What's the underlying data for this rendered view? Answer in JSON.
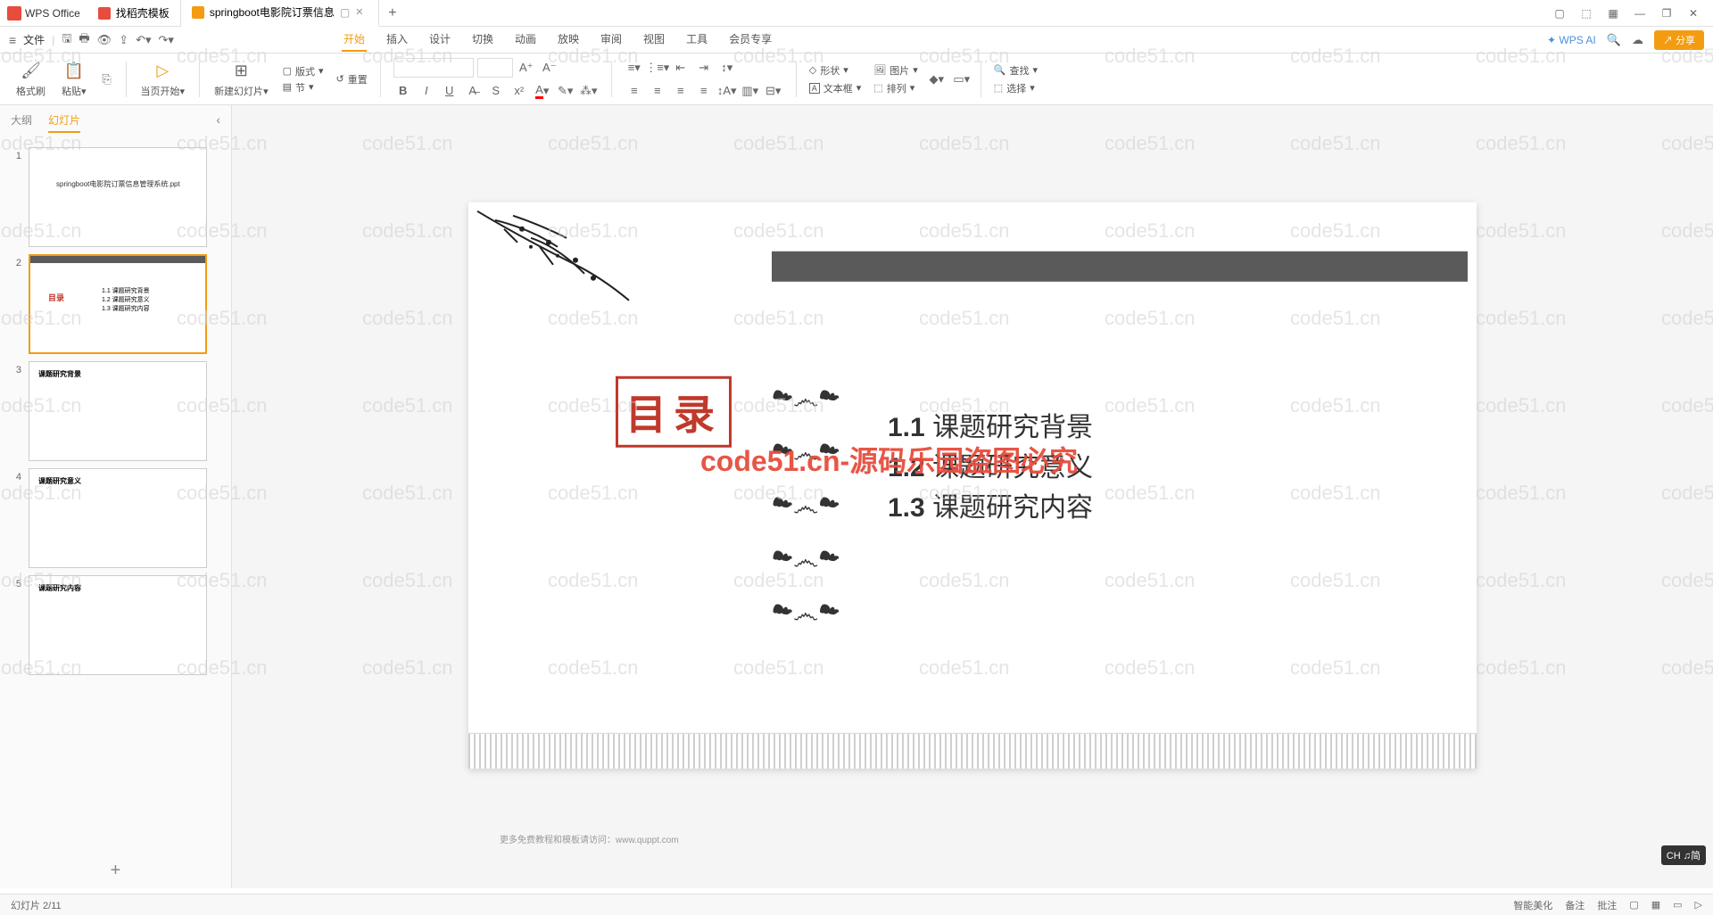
{
  "app": {
    "name": "WPS Office"
  },
  "tabs": [
    {
      "label": "找稻壳模板"
    },
    {
      "label": "springboot电影院订票信息",
      "active": true
    }
  ],
  "menubar": {
    "file": "文件",
    "tabs": [
      "开始",
      "插入",
      "设计",
      "切换",
      "动画",
      "放映",
      "审阅",
      "视图",
      "工具",
      "会员专享"
    ],
    "active_tab": "开始",
    "ai": "WPS AI",
    "share": "分享"
  },
  "toolbar": {
    "format_painter": "格式刷",
    "paste": "粘贴",
    "current_page": "当页开始",
    "new_slide": "新建幻灯片",
    "layout": "版式",
    "reset": "重置",
    "section": "节",
    "shape": "形状",
    "picture": "图片",
    "textbox": "文本框",
    "arrange": "排列",
    "find": "查找",
    "select": "选择"
  },
  "sidebar": {
    "outline": "大纲",
    "slides": "幻灯片",
    "active": "幻灯片"
  },
  "thumbs": {
    "t1_title": "springboot电影院订票信息管理系统.ppt",
    "t2_mulu": "目录",
    "t2_i1": "1.1 课题研究背景",
    "t2_i2": "1.2 课题研究意义",
    "t2_i3": "1.3 课题研究内容",
    "t3_title": "课题研究背景",
    "t4_title": "课题研究意义",
    "t5_title": "课题研究内容"
  },
  "slide": {
    "mulu": "目录",
    "item1_num": "1.1",
    "item1": "课题研究背景",
    "item2_num": "1.2",
    "item2": "课题研究意义",
    "item3_num": "1.3",
    "item3": "课题研究内容",
    "watermark_center": "code51.cn-源码乐园盗图必究",
    "footer": "更多免费教程和模板请访问：www.quppt.com"
  },
  "watermark_tile": "code51.cn",
  "ime": "CH ♫简",
  "status": {
    "left1": "幻灯片 2/11",
    "right_items": [
      "智能美化",
      "备注",
      "批注"
    ]
  }
}
